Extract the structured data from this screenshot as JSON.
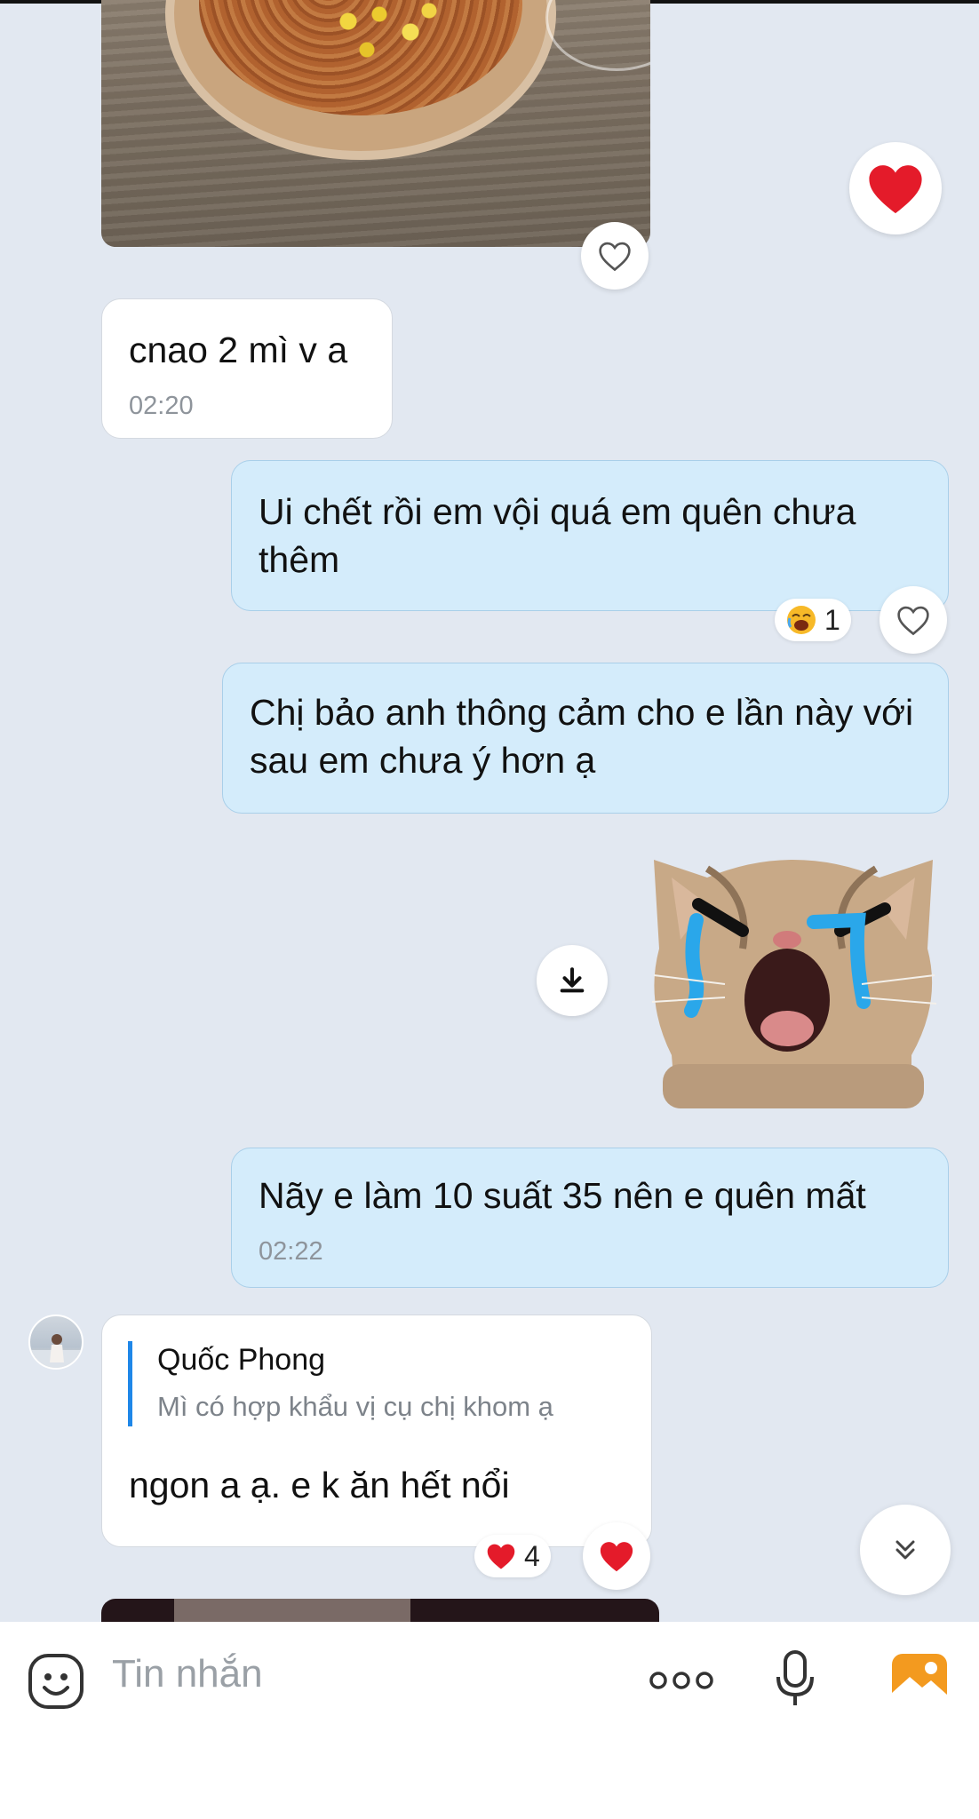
{
  "messages": {
    "m1": {
      "text": "cnao 2 mì v a",
      "time": "02:20"
    },
    "m2": {
      "text": "Ui chết rồi em vội quá em quên chưa thêm",
      "reaction_count": "1"
    },
    "m3": {
      "text": "Chị bảo anh thông cảm cho e lần này với sau em chưa ý hơn ạ"
    },
    "m4": {
      "text": "Nãy e làm 10 suất 35 nên e quên mất",
      "time": "02:22"
    },
    "m5": {
      "quote_author": "Quốc Phong",
      "quote_text": "Mì có hợp khẩu vị cụ chị khom ạ",
      "text": "ngon a ạ. e k ăn hết nổi",
      "reaction_count": "4"
    }
  },
  "composer": {
    "placeholder": "Tin nhắn"
  },
  "icons": {
    "emoji": "emoji-icon",
    "more": "more-dots-icon",
    "mic": "microphone-icon",
    "image": "image-icon",
    "heart": "heart-icon",
    "download": "download-icon",
    "scroll": "scroll-down-icon"
  },
  "colors": {
    "accent": "#f39a1f",
    "outgoing": "#d4ecfb",
    "incoming": "#ffffff",
    "heart": "#e41b2a",
    "quote_bar": "#1f87e8"
  }
}
